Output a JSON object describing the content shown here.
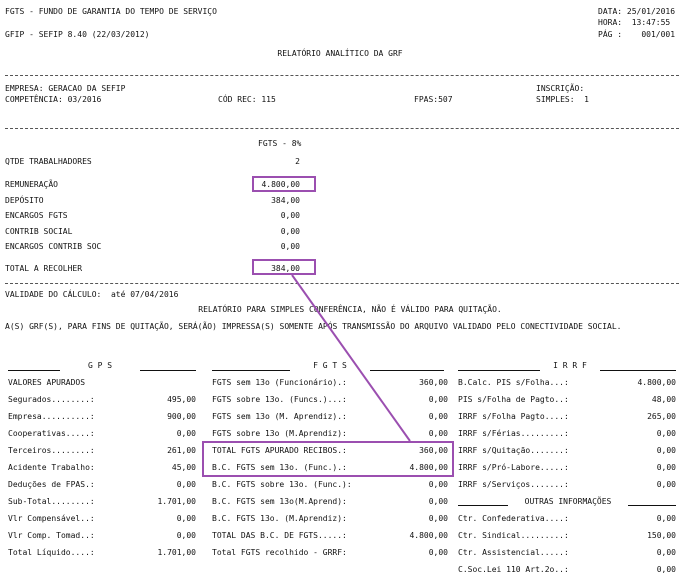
{
  "header": {
    "title": "FGTS - FUNDO DE GARANTIA DO TEMPO DE SERVIÇO",
    "system": "GFIP - SEFIP 8.40 (22/03/2012)",
    "report_title": "RELATÓRIO ANALÍTICO DA GRF",
    "date": "DATA: 25/01/2016",
    "time": "HORA:  13:47:55",
    "page": "PÁG :    001/001"
  },
  "company": {
    "empresa": "EMPRESA: GERACAO DA SEFIP",
    "competencia": "COMPETÊNCIA: 03/2016",
    "cod_rec": "CÓD REC: 115",
    "fpas": "FPAS:507",
    "inscricao": "INSCRIÇÃO:",
    "simples": "SIMPLES:  1"
  },
  "fgts": {
    "heading": "FGTS - 8%",
    "rows": [
      {
        "label": "QTDE TRABALHADORES",
        "value": "2"
      },
      {
        "label": "REMUNERAÇÃO",
        "value": "4.800,00"
      },
      {
        "label": "DEPÓSITO",
        "value": "384,00"
      },
      {
        "label": "ENCARGOS FGTS",
        "value": "0,00"
      },
      {
        "label": "CONTRIB SOCIAL",
        "value": "0,00"
      },
      {
        "label": "ENCARGOS CONTRIB SOC",
        "value": "0,00"
      },
      {
        "label": "TOTAL A RECOLHER",
        "value": "384,00"
      }
    ]
  },
  "validity": "VALIDADE DO CÁLCULO:  até 07/04/2016",
  "notice1": "RELATÓRIO PARA SIMPLES CONFERÊNCIA, NÃO É VÁLIDO PARA QUITAÇÃO.",
  "notice2": "A(S) GRF(S), PARA FINS DE QUITAÇÃO, SERÁ(ÃO) IMPRESSA(S) SOMENTE APÓS TRANSMISSÃO DO ARQUIVO VALIDADO PELO CONECTIVIDADE SOCIAL.",
  "gps": {
    "heading": "G P S",
    "subheading": "VALORES APURADOS",
    "rows": [
      {
        "label": "Segurados........:",
        "value": "495,00"
      },
      {
        "label": "Empresa..........:",
        "value": "900,00"
      },
      {
        "label": "Cooperativas.....:",
        "value": "0,00"
      },
      {
        "label": "Terceiros........:",
        "value": "261,00"
      },
      {
        "label": "Acidente Trabalho:",
        "value": "45,00"
      },
      {
        "label": "Deduções de FPAS.:",
        "value": "0,00"
      },
      {
        "label": "Sub-Total........:",
        "value": "1.701,00"
      },
      {
        "label": "Vlr Compensável..:",
        "value": "0,00"
      },
      {
        "label": "Vlr Comp. Tomad..:",
        "value": "0,00"
      },
      {
        "label": "Total Líquido....:",
        "value": "1.701,00"
      }
    ]
  },
  "fgts_detail": {
    "heading": "F G T S",
    "rows": [
      {
        "label": "FGTS sem 13o (Funcionário).:",
        "value": "360,00"
      },
      {
        "label": "FGTS sobre 13o. (Funcs.)...:",
        "value": "0,00"
      },
      {
        "label": "FGTS sem 13o (M. Aprendiz).:",
        "value": "0,00"
      },
      {
        "label": "FGTS sobre 13o (M.Aprendiz):",
        "value": "0,00"
      },
      {
        "label": "TOTAL FGTS APURADO RECIBOS.:",
        "value": "360,00"
      },
      {
        "label": "B.C. FGTS sem 13o. (Func.).:",
        "value": "4.800,00"
      },
      {
        "label": "B.C. FGTS sobre 13o. (Func.):",
        "value": "0,00"
      },
      {
        "label": "B.C. FGTS sem 13o(M.Aprend):",
        "value": "0,00"
      },
      {
        "label": "B.C. FGTS 13o. (M.Aprendiz):",
        "value": "0,00"
      },
      {
        "label": "TOTAL DAS B.C. DE FGTS.....:",
        "value": "4.800,00"
      },
      {
        "label": "Total FGTS recolhido - GRRF:",
        "value": "0,00"
      }
    ]
  },
  "irrf": {
    "heading": "I R R F",
    "rows": [
      {
        "label": "B.Calc. PIS s/Folha...:",
        "value": "4.800,00"
      },
      {
        "label": "PIS s/Folha de Pagto..:",
        "value": "48,00"
      },
      {
        "label": "IRRF s/Folha Pagto....:",
        "value": "265,00"
      },
      {
        "label": "IRRF s/Férias.........:",
        "value": "0,00"
      },
      {
        "label": "IRRF s/Quitação.......:",
        "value": "0,00"
      },
      {
        "label": "IRRF s/Pró-Labore.....:",
        "value": "0,00"
      },
      {
        "label": "IRRF s/Serviços.......:",
        "value": "0,00"
      }
    ]
  },
  "outras": {
    "heading": "OUTRAS INFORMAÇÕES",
    "rows": [
      {
        "label": "Ctr. Confederativa....:",
        "value": "0,00"
      },
      {
        "label": "Ctr. Sindical.........:",
        "value": "150,00"
      },
      {
        "label": "Ctr. Assistencial.....:",
        "value": "0,00"
      },
      {
        "label": "C.Soc.Lei 110 Art.2o..:",
        "value": "0,00"
      }
    ]
  },
  "colors": {
    "highlight": "#9b4fb0"
  }
}
